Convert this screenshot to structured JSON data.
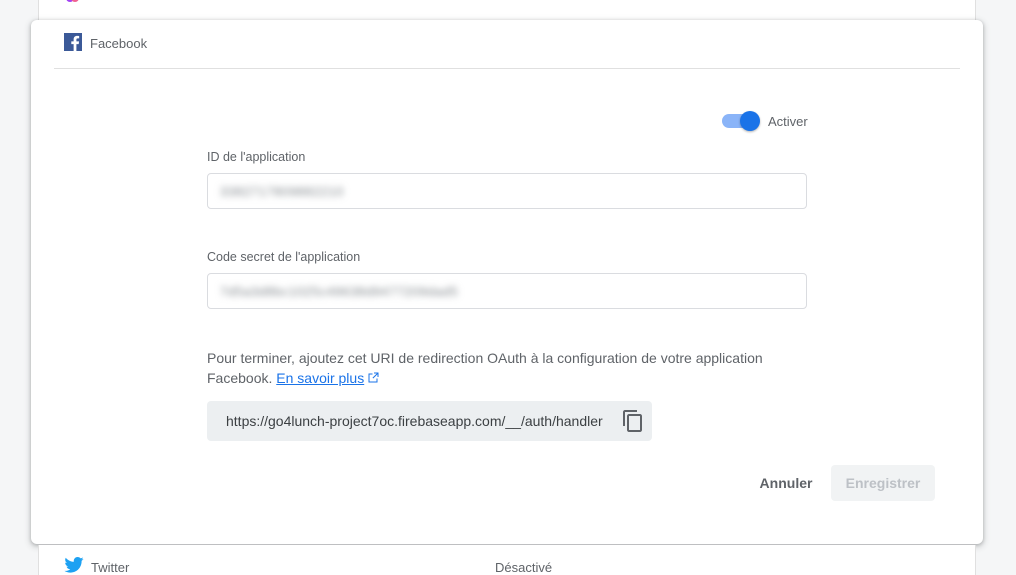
{
  "provider": {
    "name": "Facebook"
  },
  "toggle": {
    "label": "Activer",
    "enabled": true
  },
  "app_id": {
    "label": "ID de l'application",
    "value": "3382717809882210"
  },
  "app_secret": {
    "label": "Code secret de l'application",
    "value": "7d5a3d8bc1025c49638d9477209dad5"
  },
  "info": {
    "text": "Pour terminer, ajoutez cet URI de redirection OAuth à la configuration de votre application Facebook.",
    "link_label": "En savoir plus"
  },
  "redirect_uri": "https://go4lunch-project7oc.firebaseapp.com/__/auth/handler",
  "actions": {
    "cancel_label": "Annuler",
    "save_label": "Enregistrer"
  },
  "next_row": {
    "name": "Twitter",
    "status": "Désactivé"
  },
  "colors": {
    "accent": "#1a73e8",
    "facebook": "#3b5998",
    "twitter": "#1da1f2"
  },
  "icons": [
    "facebook-icon",
    "external-link-icon",
    "copy-icon",
    "twitter-icon"
  ]
}
